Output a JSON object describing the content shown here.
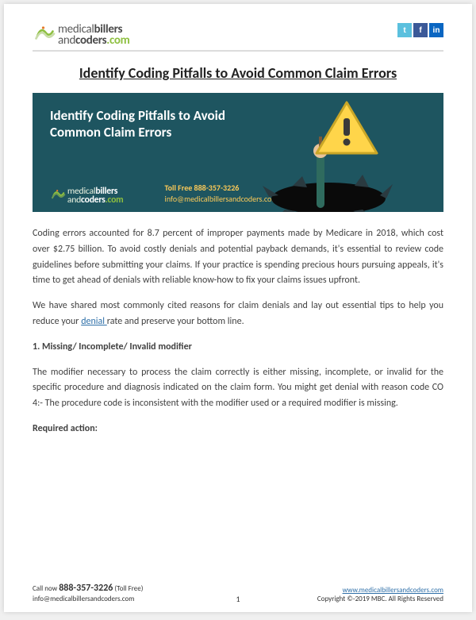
{
  "brand": {
    "line1a": "medical",
    "line1b": "billers",
    "line2a": "and",
    "line2b": "coders",
    "line2c": ".com"
  },
  "socials": {
    "twitter": "t",
    "facebook": "f",
    "linkedin": "in"
  },
  "title": "Identify Coding Pitfalls to Avoid Common Claim Errors",
  "hero": {
    "headline": "Identify Coding Pitfalls to Avoid Common Claim Errors",
    "toll_label": "Toll Free 888-357-3226",
    "email": "info@medicalbillersandcoders.com"
  },
  "body": {
    "p1": "Coding errors accounted for 8.7 percent of improper payments made by Medicare in 2018, which cost over $2.75 billion. To avoid costly denials and potential payback demands, it's essential to review code guidelines before submitting your claims. If your practice is spending precious hours pursuing appeals, it's time to get ahead of denials with reliable know-how to fix your claims issues upfront.",
    "p2a": "We have shared most commonly cited reasons for claim denials and lay out essential tips to help you reduce your ",
    "p2link": "denial ",
    "p2b": "rate and preserve your bottom line.",
    "h1": "1.  Missing/ Incomplete/ Invalid modifier",
    "p3": "The modifier necessary to process the claim correctly is either missing, incomplete, or invalid for the specific procedure and diagnosis indicated on the claim form. You might get denial with reason code CO 4:- The procedure code is inconsistent with the modifier used or a required modifier is missing.",
    "h2": "Required action:"
  },
  "footer": {
    "call_label": "Call now ",
    "phone": "888-357-3226",
    "toll_free_suffix": " (Toll Free)",
    "email": "info@medicalbillersandcoders.com",
    "page_no": "1",
    "site": "www.medicalbillersandcoders.com",
    "copyright": "Copyright ©-2019 MBC. All Rights Reserved"
  }
}
